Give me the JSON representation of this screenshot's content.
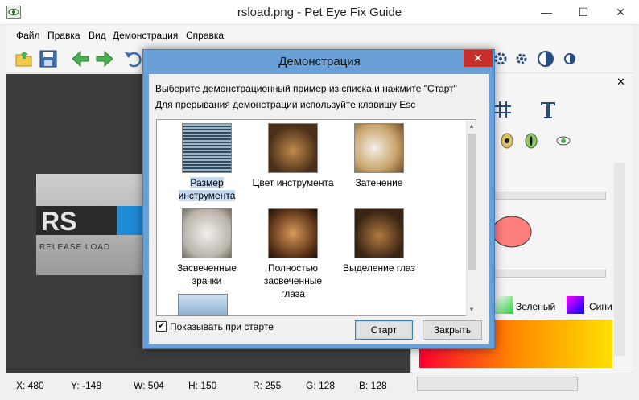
{
  "window": {
    "title": "rsload.png - Pet Eye Fix Guide",
    "minimize": "—",
    "maximize": "☐",
    "close": "✕"
  },
  "menu": [
    "Файл",
    "Правка",
    "Вид",
    "Демонстрация",
    "Справка"
  ],
  "statusbar": {
    "x": "X: 480",
    "y": "Y: -148",
    "w": "W: 504",
    "h": "H: 150",
    "r": "R: 255",
    "g": "G: 128",
    "b": "B: 128"
  },
  "right_panel": {
    "close": "✕",
    "green_label": "Зеленый",
    "blue_label": "Сини"
  },
  "preview": {
    "logo_main": "RS",
    "logo_sub": "RELEASE LOAD"
  },
  "dialog": {
    "title": "Демонстрация",
    "close": "✕",
    "line1": "Выберите демонстрационный пример из списка и нажмите \"Старт\"",
    "line2": "Для прерывания демонстрации используйте клавишу Esc",
    "items": [
      {
        "label": "Размер инструмента",
        "selected": true
      },
      {
        "label": "Цвет инструмента",
        "selected": false
      },
      {
        "label": "Затенение",
        "selected": false
      },
      {
        "label": "Засвеченные зрачки",
        "selected": false
      },
      {
        "label": "Полностью засвеченные глаза",
        "selected": false
      },
      {
        "label": "Выделение глаз",
        "selected": false
      }
    ],
    "show_on_start_label": "Показывать при старте",
    "show_on_start_checked": true,
    "start_button": "Старт",
    "close_button": "Закрыть"
  },
  "colors": {
    "accent": "#6aa0d8",
    "close_red": "#c7302a",
    "canvas": "#3c3c3c"
  }
}
